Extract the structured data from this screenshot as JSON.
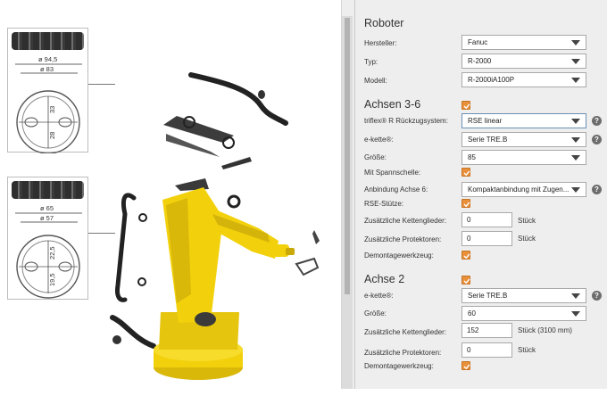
{
  "illustration": {
    "section1": {
      "outer_dia": "ø 94,5",
      "inner_dia": "ø 83",
      "inner_h": "33",
      "bottom_h": "28"
    },
    "section2": {
      "outer_dia": "ø 65",
      "inner_dia": "ø 57",
      "inner_h": "22,5",
      "bottom_h": "19,5"
    },
    "robot_color": "#f2d10c"
  },
  "panel": {
    "roboter": {
      "title": "Roboter",
      "manufacturer": {
        "label": "Hersteller:",
        "value": "Fanuc"
      },
      "type": {
        "label": "Typ:",
        "value": "R-2000"
      },
      "model": {
        "label": "Modell:",
        "value": "R-2000iA100P"
      }
    },
    "axes36": {
      "title": "Achsen 3-6",
      "retraction": {
        "label": "triflex® R Rückzugsystem:",
        "value": "RSE linear"
      },
      "echain": {
        "label": "e-kette®:",
        "value": "Serie TRE.B"
      },
      "size": {
        "label": "Größe:",
        "value": "85"
      },
      "clamp": {
        "label": "Mit Spannschelle:"
      },
      "connection": {
        "label": "Anbindung Achse 6:",
        "value": "Kompaktanbindung mit Zugen..."
      },
      "rse_support": {
        "label": "RSE-Stütze:"
      },
      "extra_links": {
        "label": "Zusätzliche Kettenglieder:",
        "value": "0",
        "unit": "Stück"
      },
      "extra_protectors": {
        "label": "Zusätzliche Protektoren:",
        "value": "0",
        "unit": "Stück"
      },
      "tool": {
        "label": "Demontagewerkzeug:"
      }
    },
    "axis2": {
      "title": "Achse 2",
      "echain": {
        "label": "e-kette®:",
        "value": "Serie TRE.B"
      },
      "size": {
        "label": "Größe:",
        "value": "60"
      },
      "extra_links": {
        "label": "Zusätzliche Kettenglieder:",
        "value": "152",
        "unit": "Stück (3100 mm)"
      },
      "extra_protectors": {
        "label": "Zusätzliche Protektoren:",
        "value": "0",
        "unit": "Stück"
      },
      "tool": {
        "label": "Demontagewerkzeug:"
      }
    },
    "help_glyph": "?",
    "accent_color": "#e8903a"
  }
}
